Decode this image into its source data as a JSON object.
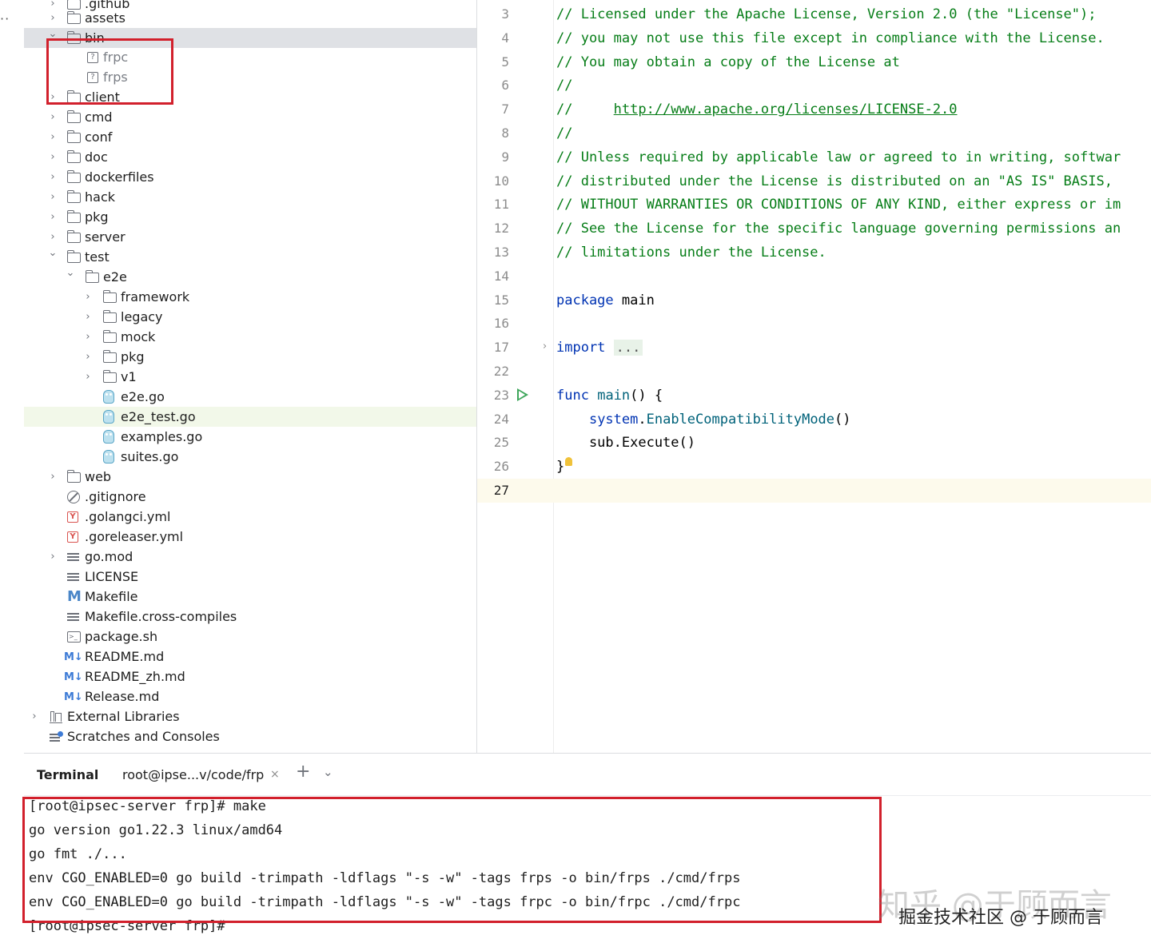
{
  "gutter": {
    "menu_glyph": "··"
  },
  "tree": {
    "rows": [
      {
        "label": ".github",
        "type": "folder",
        "depth": 1,
        "chevron": "collapsed"
      },
      {
        "label": "assets",
        "type": "folder",
        "depth": 1,
        "chevron": "collapsed"
      },
      {
        "label": "bin",
        "type": "folder",
        "depth": 1,
        "chevron": "expanded",
        "selected": true
      },
      {
        "label": "frpc",
        "type": "unknown",
        "depth": 2,
        "chevron": "none",
        "muted": true
      },
      {
        "label": "frps",
        "type": "unknown",
        "depth": 2,
        "chevron": "none",
        "muted": true
      },
      {
        "label": "client",
        "type": "folder",
        "depth": 1,
        "chevron": "collapsed"
      },
      {
        "label": "cmd",
        "type": "folder",
        "depth": 1,
        "chevron": "collapsed"
      },
      {
        "label": "conf",
        "type": "folder",
        "depth": 1,
        "chevron": "collapsed"
      },
      {
        "label": "doc",
        "type": "folder",
        "depth": 1,
        "chevron": "collapsed"
      },
      {
        "label": "dockerfiles",
        "type": "folder",
        "depth": 1,
        "chevron": "collapsed"
      },
      {
        "label": "hack",
        "type": "folder",
        "depth": 1,
        "chevron": "collapsed"
      },
      {
        "label": "pkg",
        "type": "folder",
        "depth": 1,
        "chevron": "collapsed"
      },
      {
        "label": "server",
        "type": "folder",
        "depth": 1,
        "chevron": "collapsed"
      },
      {
        "label": "test",
        "type": "folder",
        "depth": 1,
        "chevron": "expanded"
      },
      {
        "label": "e2e",
        "type": "folder",
        "depth": 2,
        "chevron": "expanded"
      },
      {
        "label": "framework",
        "type": "folder",
        "depth": 3,
        "chevron": "collapsed"
      },
      {
        "label": "legacy",
        "type": "folder",
        "depth": 3,
        "chevron": "collapsed"
      },
      {
        "label": "mock",
        "type": "folder",
        "depth": 3,
        "chevron": "collapsed"
      },
      {
        "label": "pkg",
        "type": "folder",
        "depth": 3,
        "chevron": "collapsed"
      },
      {
        "label": "v1",
        "type": "folder",
        "depth": 3,
        "chevron": "collapsed"
      },
      {
        "label": "e2e.go",
        "type": "go",
        "depth": 3,
        "chevron": "none"
      },
      {
        "label": "e2e_test.go",
        "type": "go",
        "depth": 3,
        "chevron": "none",
        "highlight": true
      },
      {
        "label": "examples.go",
        "type": "go",
        "depth": 3,
        "chevron": "none"
      },
      {
        "label": "suites.go",
        "type": "go",
        "depth": 3,
        "chevron": "none"
      },
      {
        "label": "web",
        "type": "folder",
        "depth": 1,
        "chevron": "collapsed"
      },
      {
        "label": ".gitignore",
        "type": "ignore",
        "depth": 1,
        "chevron": "none"
      },
      {
        "label": ".golangci.yml",
        "type": "yml",
        "depth": 1,
        "chevron": "none"
      },
      {
        "label": ".goreleaser.yml",
        "type": "yml",
        "depth": 1,
        "chevron": "none"
      },
      {
        "label": "go.mod",
        "type": "text",
        "depth": 1,
        "chevron": "collapsed"
      },
      {
        "label": "LICENSE",
        "type": "text",
        "depth": 1,
        "chevron": "none"
      },
      {
        "label": "Makefile",
        "type": "makefile",
        "depth": 1,
        "chevron": "none"
      },
      {
        "label": "Makefile.cross-compiles",
        "type": "text",
        "depth": 1,
        "chevron": "none"
      },
      {
        "label": "package.sh",
        "type": "shell",
        "depth": 1,
        "chevron": "none"
      },
      {
        "label": "README.md",
        "type": "markdown",
        "depth": 1,
        "chevron": "none"
      },
      {
        "label": "README_zh.md",
        "type": "markdown",
        "depth": 1,
        "chevron": "none"
      },
      {
        "label": "Release.md",
        "type": "markdown",
        "depth": 1,
        "chevron": "none"
      },
      {
        "label": "External Libraries",
        "type": "library",
        "depth": 0,
        "chevron": "collapsed"
      },
      {
        "label": "Scratches and Consoles",
        "type": "scratch",
        "depth": 0,
        "chevron": "none"
      }
    ],
    "icons": {
      "unknown": "?",
      "yml": "Y",
      "makefile": "M",
      "shell": ">_",
      "markdown": "M↓"
    }
  },
  "editor": {
    "lines": [
      {
        "n": "3",
        "tokens": [
          {
            "t": "// Licensed under the Apache License, Version 2.0 (the \"License\");",
            "c": "cmt"
          }
        ]
      },
      {
        "n": "4",
        "tokens": [
          {
            "t": "// you may not use this file except in compliance with the License.",
            "c": "cmt"
          }
        ]
      },
      {
        "n": "5",
        "tokens": [
          {
            "t": "// You may obtain a copy of the License at",
            "c": "cmt"
          }
        ]
      },
      {
        "n": "6",
        "tokens": [
          {
            "t": "//",
            "c": "cmt"
          }
        ]
      },
      {
        "n": "7",
        "tokens": [
          {
            "t": "//     ",
            "c": "cmt"
          },
          {
            "t": "http://www.apache.org/licenses/LICENSE-2.0",
            "c": "lnk"
          }
        ]
      },
      {
        "n": "8",
        "tokens": [
          {
            "t": "//",
            "c": "cmt"
          }
        ]
      },
      {
        "n": "9",
        "tokens": [
          {
            "t": "// Unless required by applicable law or agreed to in writing, softwar",
            "c": "cmt"
          }
        ]
      },
      {
        "n": "10",
        "tokens": [
          {
            "t": "// distributed under the License is distributed on an \"AS IS\" BASIS,",
            "c": "cmt"
          }
        ]
      },
      {
        "n": "11",
        "tokens": [
          {
            "t": "// WITHOUT WARRANTIES OR CONDITIONS OF ANY KIND, either express or im",
            "c": "cmt"
          }
        ]
      },
      {
        "n": "12",
        "tokens": [
          {
            "t": "// See the License for the specific language governing permissions an",
            "c": "cmt"
          }
        ]
      },
      {
        "n": "13",
        "tokens": [
          {
            "t": "// limitations under the License.",
            "c": "cmt"
          }
        ]
      },
      {
        "n": "14",
        "tokens": []
      },
      {
        "n": "15",
        "tokens": [
          {
            "t": "package",
            "c": "kw"
          },
          {
            "t": " main",
            "c": "pkg"
          }
        ]
      },
      {
        "n": "16",
        "tokens": []
      },
      {
        "n": "17",
        "tokens": [
          {
            "t": "import",
            "c": "kw"
          },
          {
            "t": " ",
            "c": "pkg"
          },
          {
            "t": "...",
            "c": "dots2"
          }
        ]
      },
      {
        "n": "22",
        "tokens": []
      },
      {
        "n": "23",
        "tokens": [
          {
            "t": "func",
            "c": "kw"
          },
          {
            "t": " ",
            "c": "pkg"
          },
          {
            "t": "main",
            "c": "fn"
          },
          {
            "t": "() {",
            "c": "pkg"
          }
        ]
      },
      {
        "n": "24",
        "tokens": [
          {
            "t": "    ",
            "c": "pkg"
          },
          {
            "t": "system",
            "c": "kw"
          },
          {
            "t": ".",
            "c": "pkg"
          },
          {
            "t": "EnableCompatibilityMode",
            "c": "callm"
          },
          {
            "t": "()",
            "c": "pkg"
          }
        ]
      },
      {
        "n": "25",
        "tokens": [
          {
            "t": "    sub.Execute()",
            "c": "pkg"
          }
        ]
      },
      {
        "n": "26",
        "tokens": [
          {
            "t": "}",
            "c": "pkg"
          }
        ]
      },
      {
        "n": "27",
        "tokens": [],
        "current": true
      }
    ]
  },
  "terminal": {
    "title": "Terminal",
    "tab_label": "root@ipse...v/code/frp",
    "close_glyph": "×",
    "add_glyph": "+",
    "menu_glyph": "⌄",
    "lines": [
      "[root@ipsec-server frp]# make",
      "go version go1.22.3 linux/amd64",
      "go fmt ./...",
      "env CGO_ENABLED=0 go build -trimpath -ldflags \"-s -w\" -tags frps -o bin/frps ./cmd/frps",
      "env CGO_ENABLED=0 go build -trimpath -ldflags \"-s -w\" -tags frpc -o bin/frpc ./cmd/frpc",
      "[root@ipsec-server frp]#"
    ]
  },
  "watermark": {
    "text": "掘金技术社区 @ 于顾而言",
    "faint_text": "知乎 @于顾而言"
  },
  "colors": {
    "annotation_red": "#d2202c",
    "comment_green": "#067d17",
    "keyword_blue": "#0033b3",
    "run_green": "#3ea65b"
  }
}
